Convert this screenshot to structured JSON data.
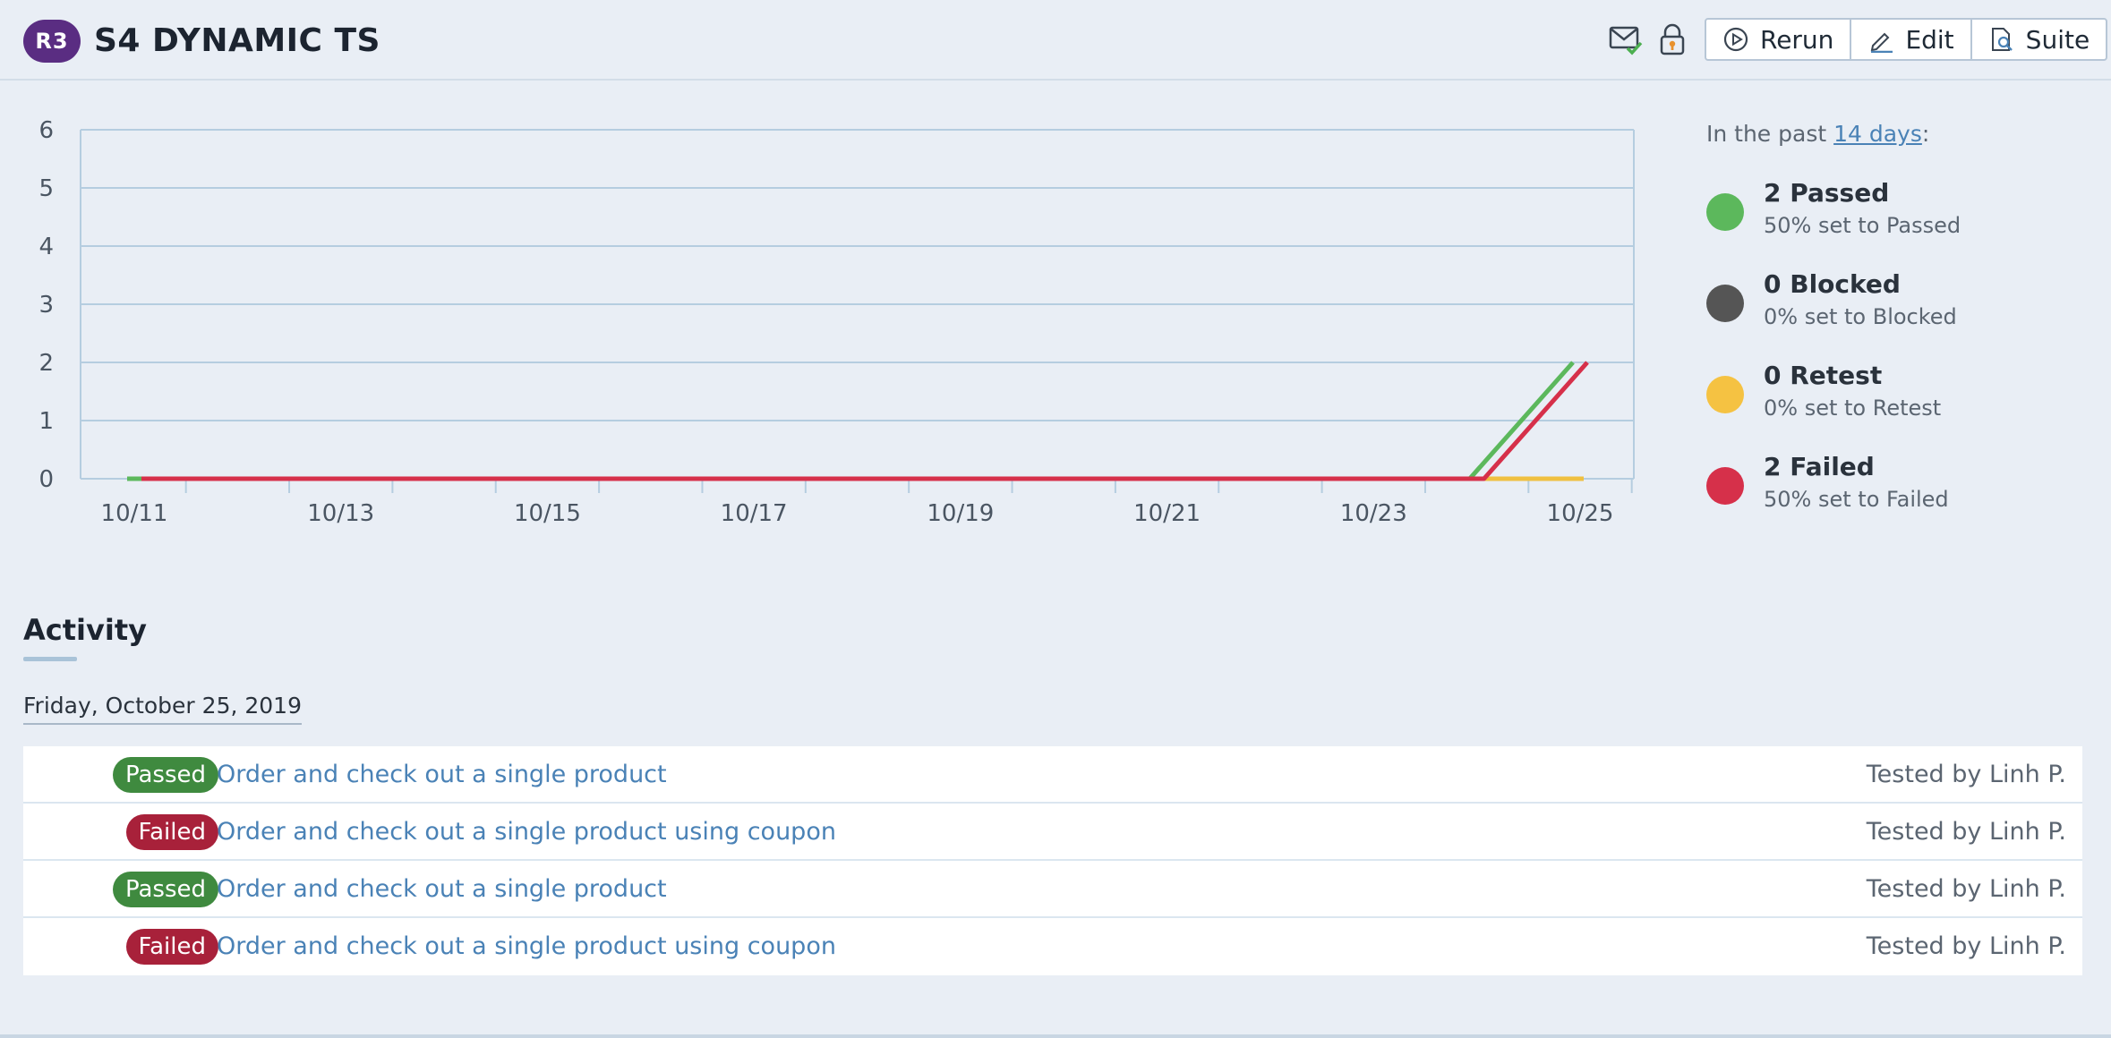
{
  "header": {
    "run_badge": "R3",
    "title": "S4 DYNAMIC TS",
    "icons": [
      "mail-check-icon",
      "lock-icon"
    ],
    "buttons": {
      "rerun": "Rerun",
      "edit": "Edit",
      "suite": "Suite"
    }
  },
  "chart_data": {
    "type": "line",
    "x": [
      "10/11",
      "10/12",
      "10/13",
      "10/14",
      "10/15",
      "10/16",
      "10/17",
      "10/18",
      "10/19",
      "10/20",
      "10/21",
      "10/22",
      "10/23",
      "10/24",
      "10/25"
    ],
    "tick_labels": [
      "10/11",
      "10/13",
      "10/15",
      "10/17",
      "10/19",
      "10/21",
      "10/23",
      "10/25"
    ],
    "y_ticks": [
      "0",
      "1",
      "2",
      "3",
      "4",
      "5",
      "6"
    ],
    "ylim": [
      0,
      6
    ],
    "grid": true,
    "series": [
      {
        "color": "#5cb85c",
        "values": [
          0,
          0,
          0,
          0,
          0,
          0,
          0,
          0,
          0,
          0,
          0,
          0,
          0,
          0,
          2
        ]
      },
      {
        "color": "#555555",
        "values": [
          0,
          0,
          0,
          0,
          0,
          0,
          0,
          0,
          0,
          0,
          0,
          0,
          0,
          0,
          0
        ]
      },
      {
        "color": "#f0c040",
        "values": [
          0,
          0,
          0,
          0,
          0,
          0,
          0,
          0,
          0,
          0,
          0,
          0,
          0,
          0,
          0
        ]
      },
      {
        "color": "#d6304a",
        "values": [
          0,
          0,
          0,
          0,
          0,
          0,
          0,
          0,
          0,
          0,
          0,
          0,
          0,
          0,
          2
        ]
      }
    ]
  },
  "legend": {
    "intro_prefix": "In the past ",
    "intro_link": "14 days",
    "intro_suffix": ":",
    "items": [
      {
        "count": "2 Passed",
        "sub": "50% set to Passed",
        "color": "#5cb85c"
      },
      {
        "count": "0 Blocked",
        "sub": "0% set to Blocked",
        "color": "#555555"
      },
      {
        "count": "0 Retest",
        "sub": "0% set to Retest",
        "color": "#f5c242"
      },
      {
        "count": "2 Failed",
        "sub": "50% set to Failed",
        "color": "#d6304a"
      }
    ]
  },
  "activity": {
    "title": "Activity",
    "date": "Friday, October 25, 2019",
    "rows": [
      {
        "status": "Passed",
        "status_color": "#3f8a3f",
        "test": "Order and check out a single product",
        "tester": "Tested by Linh P."
      },
      {
        "status": "Failed",
        "status_color": "#a8213a",
        "test": "Order and check out a single product using coupon",
        "tester": "Tested by Linh P."
      },
      {
        "status": "Passed",
        "status_color": "#3f8a3f",
        "test": "Order and check out a single product",
        "tester": "Tested by Linh P."
      },
      {
        "status": "Failed",
        "status_color": "#a8213a",
        "test": "Order and check out a single product using coupon",
        "tester": "Tested by Linh P."
      }
    ]
  }
}
